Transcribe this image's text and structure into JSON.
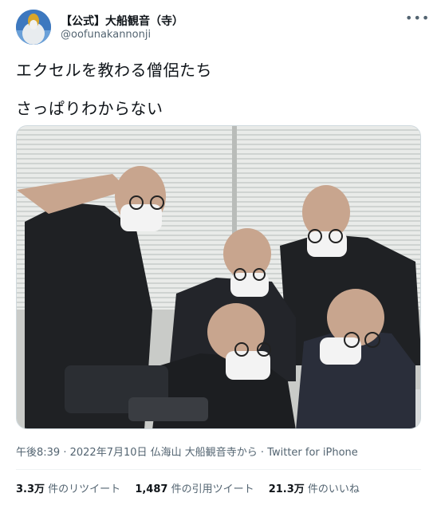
{
  "user": {
    "display_name": "【公式】大船観音（寺）",
    "handle": "@oofunakannonji",
    "avatar_icon": "avatar-kannon-statue"
  },
  "more_icon": "more-dots-icon",
  "tweet": {
    "line1": "エクセルを教わる僧侶たち",
    "line2": "さっぱりわからない"
  },
  "meta": {
    "time": "午後8:39",
    "sep1": " · ",
    "date": "2022年7月10日",
    "space": " ",
    "source": "仏海山 大船観音寺から",
    "sep2": " · ",
    "client": "Twitter for iPhone"
  },
  "stats": {
    "retweets": {
      "count": "3.3万",
      "label": " 件のリツイート"
    },
    "quotes": {
      "count": "1,487",
      "label": " 件の引用ツイート"
    },
    "likes": {
      "count": "21.3万",
      "label": " 件のいいね"
    }
  },
  "colors": {
    "text": "#0f1419",
    "secondary": "#536471",
    "border": "#cfd9de"
  }
}
